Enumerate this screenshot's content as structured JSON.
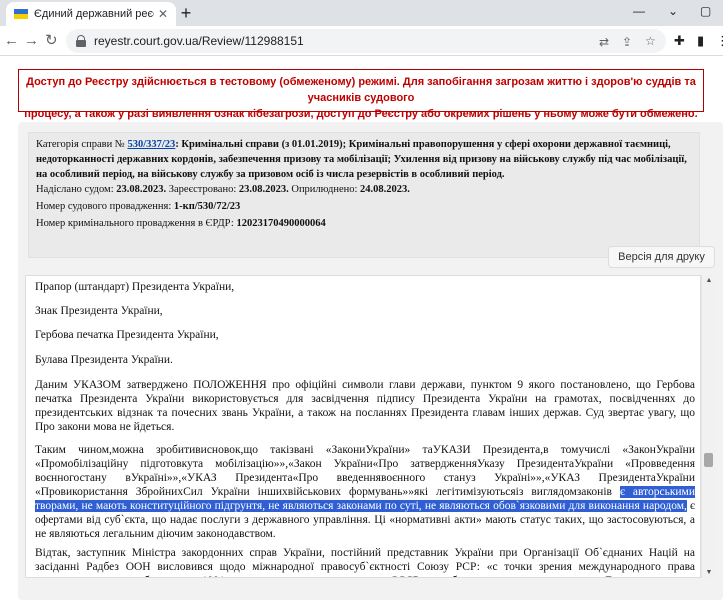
{
  "browser": {
    "tab_title": "Єдиний державний реєстр судо",
    "url": "reyestr.court.gov.ua/Review/112988151",
    "new_tab_symbol": "+",
    "close_symbol": "✕"
  },
  "banner": {
    "line1": "Доступ до Реєстру здійснюється в тестовому (обмеженому) режимі. Для запобігання загрозам життю і здоров'ю суддів та учасників судового",
    "line2": "процесу, а також у разі виявлення ознак кібезагрози, доступ до Реєстру або окремих рішень у ньому може бути обмежено."
  },
  "case": {
    "category_label": "Категорія справи №",
    "case_number": "530/337/23",
    "category_text": ": Кримінальні справи (з 01.01.2019); Кримінальні правопорушення у сфері охорони державної таємниці, недоторканності державних кордонів, забезпечення призову та мобілізації; Ухилення від призову на військову службу під час мобілізації, на особливий період, на військову службу за призовом осіб із числа резервістів в особливий період.",
    "sent_label": "Надіслано судом:",
    "sent_date": "23.08.2023.",
    "registered_label": "Зареєстровано:",
    "registered_date": "23.08.2023.",
    "published_label": "Оприлюднено:",
    "published_date": "24.08.2023.",
    "proceeding_label": "Номер судового провадження:",
    "proceeding_number": "1-кп/530/72/23",
    "erdr_label": "Номер кримінального провадження в ЄРДР:",
    "erdr_number": "12023170490000064"
  },
  "print_button": "Версія для друку",
  "document": {
    "p1": "Прапор (штандарт) Президента України,",
    "p2": "Знак Президента України,",
    "p3": "Гербова печатка Президента України,",
    "p4": "Булава Президента України.",
    "p5": "Даним УКАЗОМ затверджено ПОЛОЖЕННЯ про офіційні символи глави держави, пунктом 9 якого постановлено, що Гербова печатка Президента України використовується для засвідчення підпису Президента України на грамотах, посвідченнях до президентських відзнак та почесних звань України, а також на посланнях Президента главам інших держав. Суд звертає увагу, що Про закони мова не йдеться.",
    "p6_before": "Таким чином,можна зробитивисновок,що такізвані «ЗакониУкраїни» таУКАЗИ Президента,в томучислі «ЗаконУкраїни «Промобілізаційну підготовкута мобілізацію»»,«Закон України«Про затвердженняУказу ПрезидентаУкраїни «Провведення воєнногостану вУкраїні»»,«УКАЗ Президента«Про введеннявоєнного стануз Україні»»,«УКАЗ ПрезидентаУкраїни «Провикористання ЗбройнихСил України іншихвійськових формувань»»які легітимізуютьсяіз виглядомзаконів ",
    "p6_highlight": "є авторськими творами, не мають конституційного підгрунтя, не являються законами по суті, не являються обов`язковими для виконання народом,",
    "p6_after": " є офертами від суб`єкта, що надає послуги з державного управління. Ці «нормативні акти» мають статус таких, що застосовуються, а не являються легальним діючим законодавством.",
    "p7": "Відтак, заступник Міністра закордонних справ України, постійний представник України при Організації Об`єднаних Націй на засіданні Радбез ООН висловився щодо міжнародної правосуб`єктності Союзу РСР: «с точки зрения международного права геополитические преобразования 1991 года не привели к исчезновению СССР как субъекта международного права. Государство"
  }
}
